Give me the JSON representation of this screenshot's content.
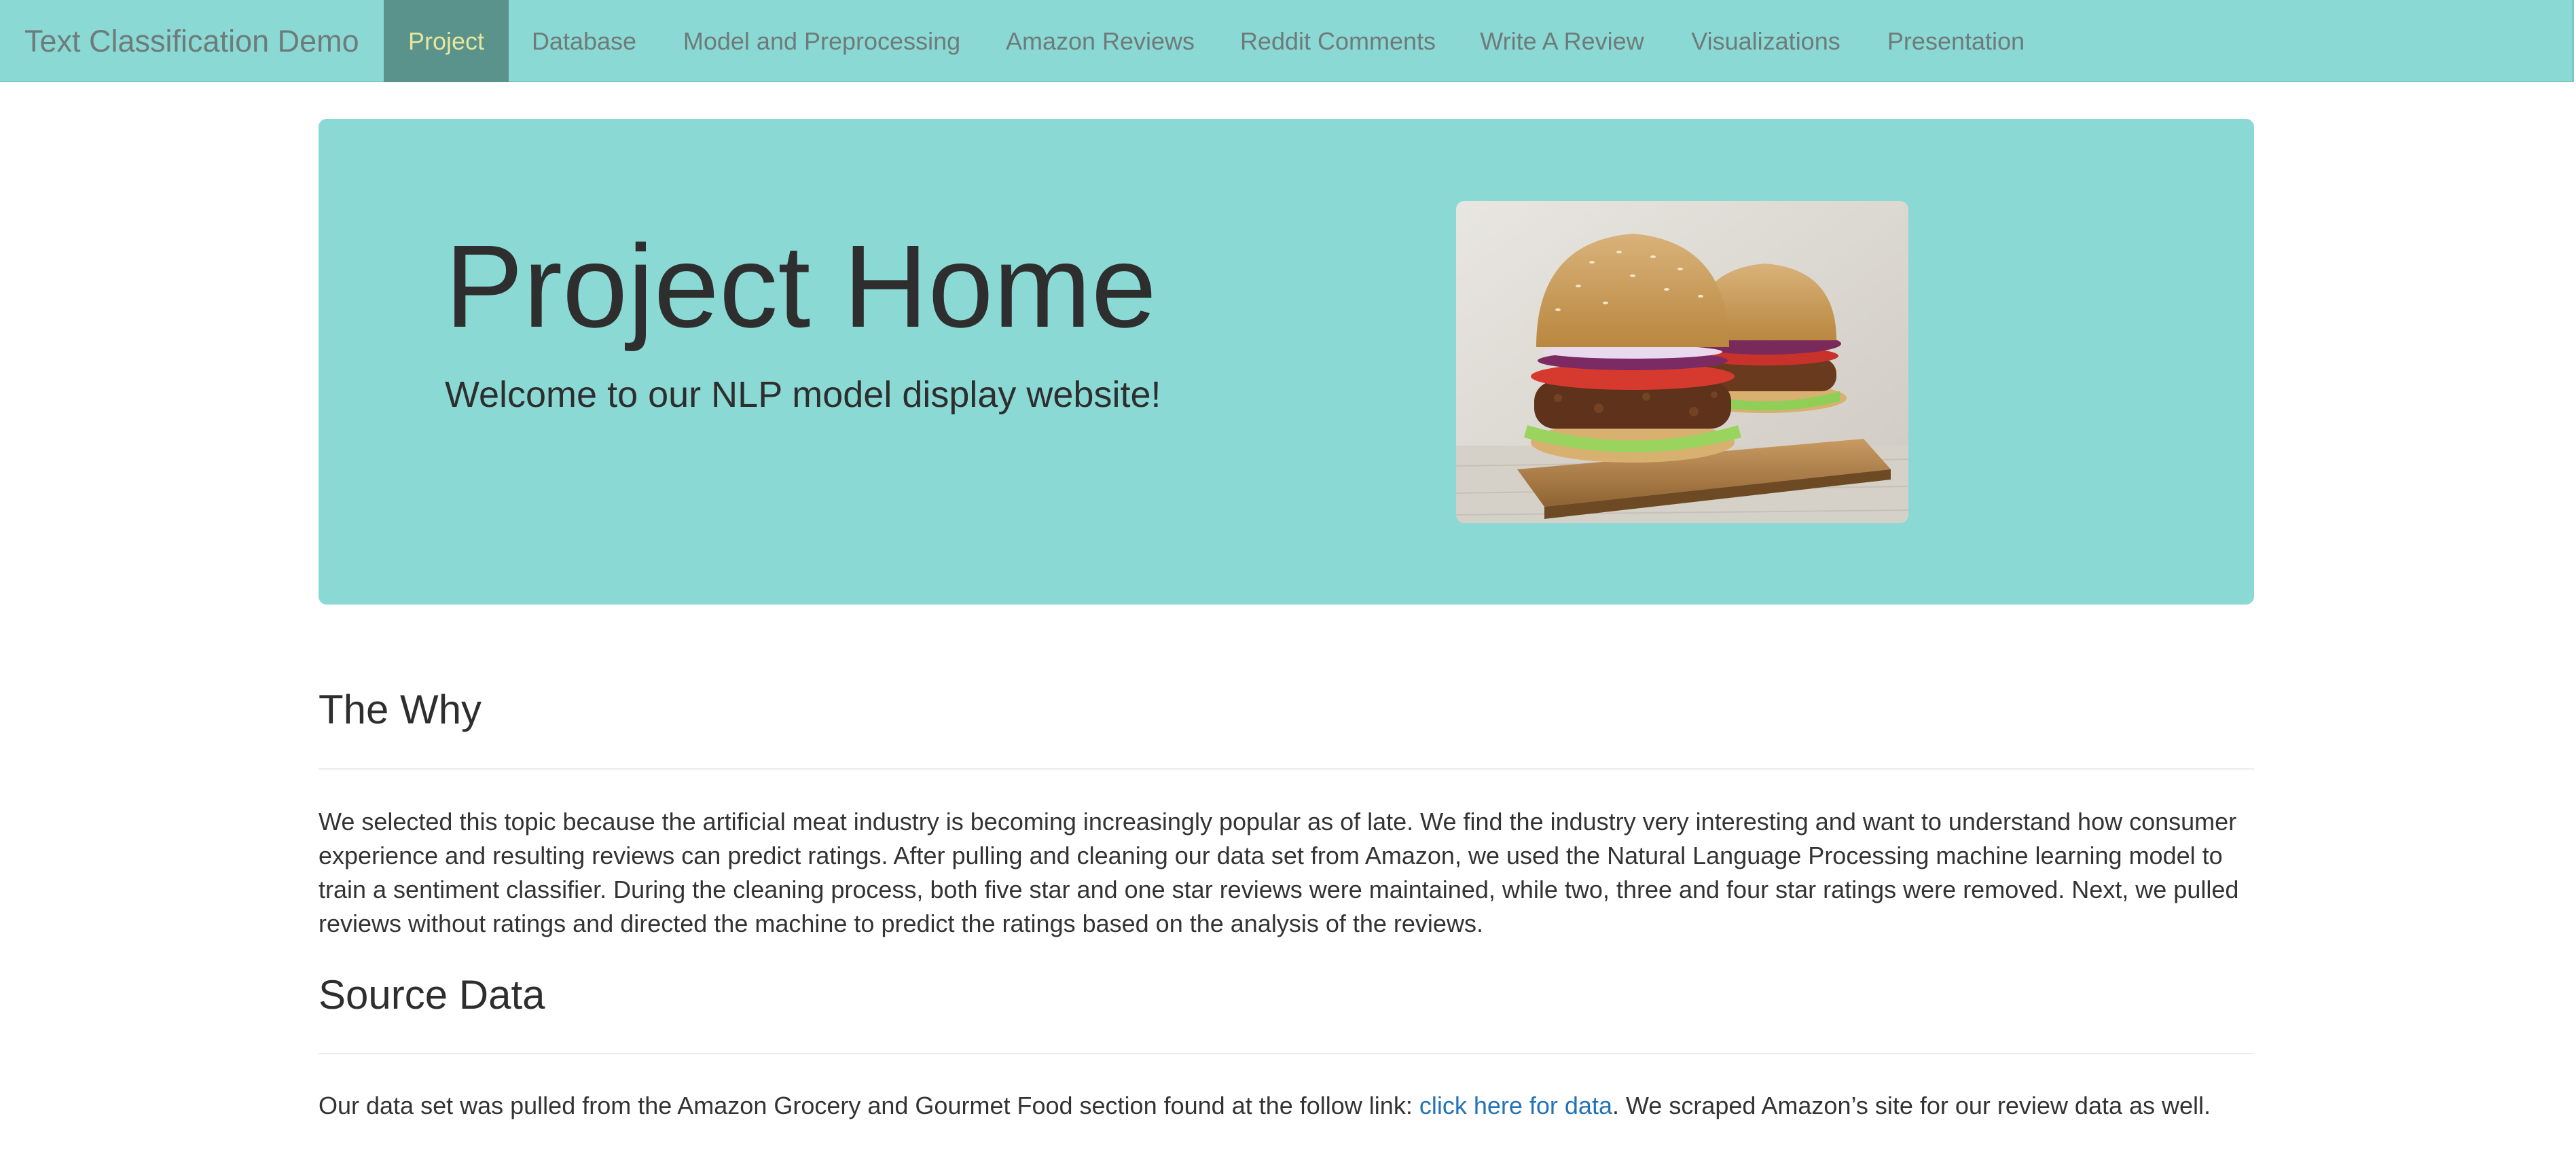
{
  "nav": {
    "brand": "Text Classification Demo",
    "items": [
      {
        "label": "Project",
        "active": true
      },
      {
        "label": "Database"
      },
      {
        "label": "Model and Preprocessing"
      },
      {
        "label": "Amazon Reviews"
      },
      {
        "label": "Reddit Comments"
      },
      {
        "label": "Write A Review"
      },
      {
        "label": "Visualizations"
      },
      {
        "label": "Presentation"
      }
    ]
  },
  "hero": {
    "title": "Project Home",
    "subtitle": "Welcome to our NLP model display website!",
    "image": "burger-photo"
  },
  "why": {
    "heading": "The Why",
    "text": "We selected this topic because the artificial meat industry is becoming increasingly popular as of late. We find the industry very interesting and want to understand how consumer experience and resulting reviews can predict ratings. After pulling and cleaning our data set from Amazon, we used the Natural Language Processing machine learning model to train a sentiment classifier. During the cleaning process, both five star and one star reviews were maintained, while two, three and four star ratings were removed. Next, we pulled reviews without ratings and directed the machine to predict the ratings based on the analysis of the reviews."
  },
  "source": {
    "heading": "Source Data",
    "text_before": "Our data set was pulled from the Amazon Grocery and Gourmet Food section found at the follow link: ",
    "link_label": "click here for data",
    "text_after": ". We scraped Amazon’s site for our review data as well."
  },
  "colors": {
    "navbar": "#8ad9d4",
    "nav_active_bg": "#5a928c",
    "nav_active_text": "#e6e79c",
    "link": "#2273b8"
  }
}
